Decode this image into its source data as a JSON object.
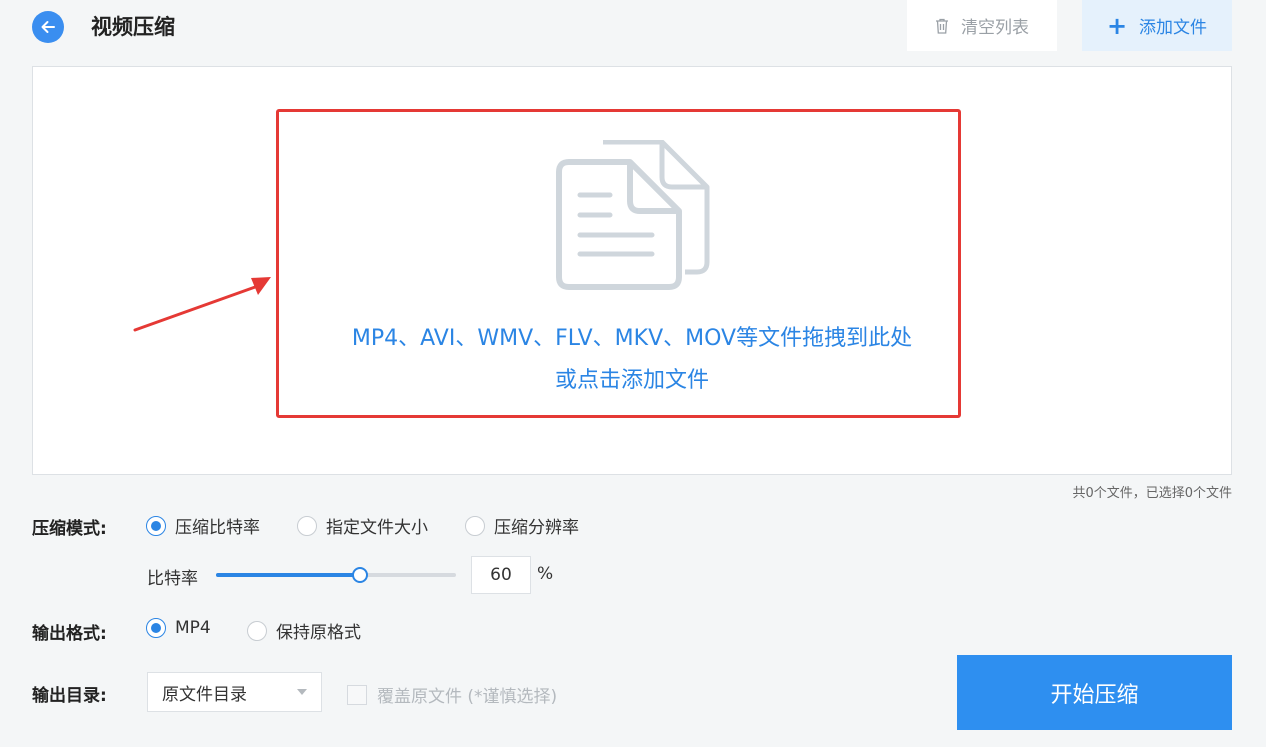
{
  "header": {
    "title": "视频压缩",
    "clear_label": "清空列表",
    "add_label": "添加文件",
    "back_icon": "arrow-left-icon",
    "clear_icon": "trash-icon",
    "add_icon": "plus-icon"
  },
  "drop_area": {
    "line1": "MP4、AVI、WMV、FLV、MKV、MOV等文件拖拽到此处",
    "line2": "或点击添加文件",
    "icon": "document-icon"
  },
  "file_count": "共0个文件，已选择0个文件",
  "compress_mode": {
    "label": "压缩模式:",
    "options": [
      "压缩比特率",
      "指定文件大小",
      "压缩分辨率"
    ],
    "selected": "压缩比特率"
  },
  "bitrate": {
    "label": "比特率",
    "value": "60",
    "unit": "%",
    "slider_fraction": 0.6
  },
  "output_format": {
    "label": "输出格式:",
    "options": [
      "MP4",
      "保持原格式"
    ],
    "selected": "MP4"
  },
  "output_dir": {
    "label": "输出目录:",
    "selected": "原文件目录",
    "overwrite_label": "覆盖原文件 (*谨慎选择)",
    "overwrite_checked": false
  },
  "start_button": "开始压缩",
  "colors": {
    "accent": "#2b85e4",
    "highlight": "#e53935",
    "start_button": "#2e8ff0"
  }
}
